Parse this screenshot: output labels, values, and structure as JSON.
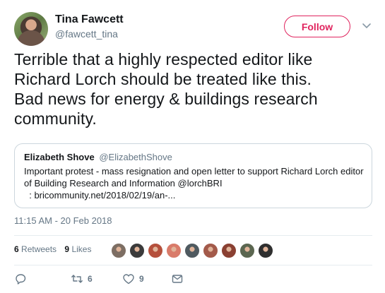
{
  "author": {
    "name": "Tina Fawcett",
    "handle": "@fawcett_tina"
  },
  "follow_label": "Follow",
  "tweet_lines": [
    "Terrible that a highly respected editor like",
    "Richard Lorch should be treated like this.",
    "Bad news for energy & buildings research",
    "community."
  ],
  "quote": {
    "name": "Elizabeth Shove",
    "handle": "@ElizabethShove",
    "lines": [
      "Important protest - mass resignation and open letter to support Richard Lorch editor",
      "of Building Research and Information @lorchBRI",
      "  : bricommunity.net/2018/02/19/an-..."
    ]
  },
  "timestamp": "11:15 AM - 20 Feb 2018",
  "stats": {
    "retweets_count": "6",
    "retweets_label": "Retweets",
    "likes_count": "9",
    "likes_label": "Likes"
  },
  "liker_colors": [
    "#7d6e63",
    "#3b3b3b",
    "#b5503c",
    "#d97b6a",
    "#4f5a60",
    "#a35a4a",
    "#8a4032",
    "#5b6650",
    "#2f2f2f"
  ],
  "actions": {
    "reply_icon": "reply-icon",
    "retweet_icon": "retweet-icon",
    "retweet_count": "6",
    "like_icon": "heart-icon",
    "like_count": "9",
    "dm_icon": "envelope-icon"
  },
  "colors": {
    "accent": "#e0245e",
    "secondary_text": "#657786",
    "border": "#ccd6dd"
  }
}
